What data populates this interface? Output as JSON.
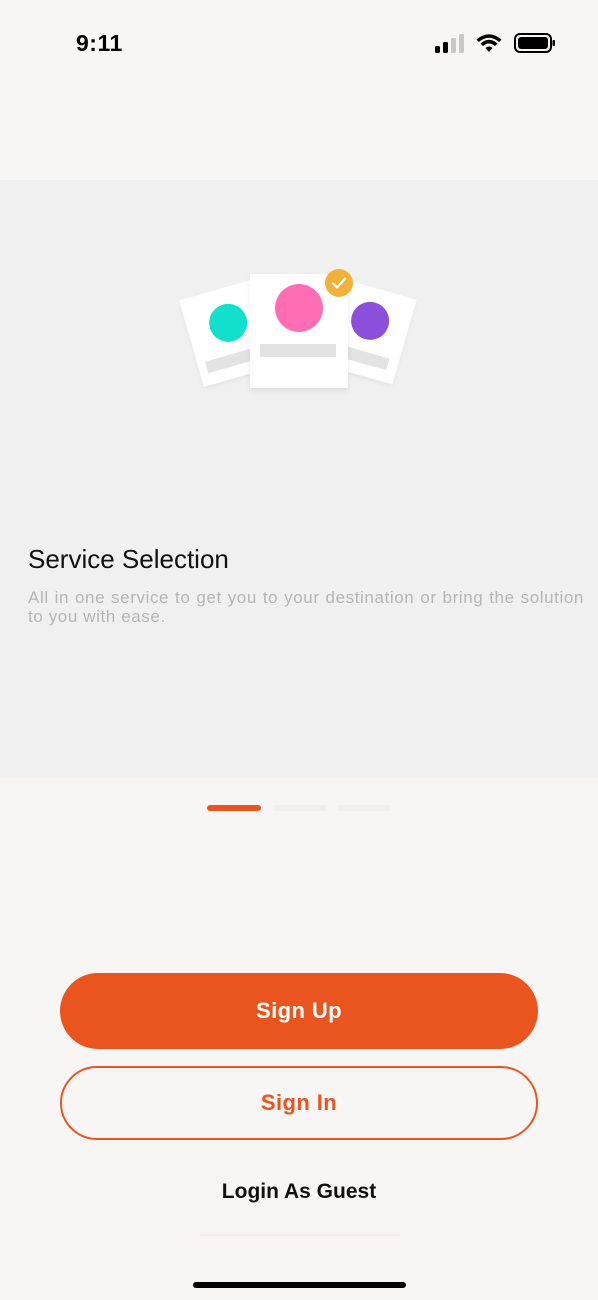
{
  "status_bar": {
    "time": "9:11",
    "signal_icon": "cellular-signal-icon",
    "wifi_icon": "wifi-icon",
    "battery_icon": "battery-icon"
  },
  "onboarding": {
    "illustration_icon": "service-cards-illustration",
    "check_icon": "check-badge-icon",
    "title": "Service Selection",
    "description": "All in one service to get you to your destination or bring the solution to you with ease.",
    "pager": {
      "current": 1,
      "total": 3
    }
  },
  "actions": {
    "sign_up_label": "Sign Up",
    "sign_in_label": "Sign In",
    "guest_label": "Login As Guest"
  },
  "colors": {
    "accent": "#e9541f",
    "card_teal": "#12dfcc",
    "card_pink": "#ff6eb5",
    "card_purple": "#8c4fd9",
    "check_badge": "#f2b23a"
  }
}
